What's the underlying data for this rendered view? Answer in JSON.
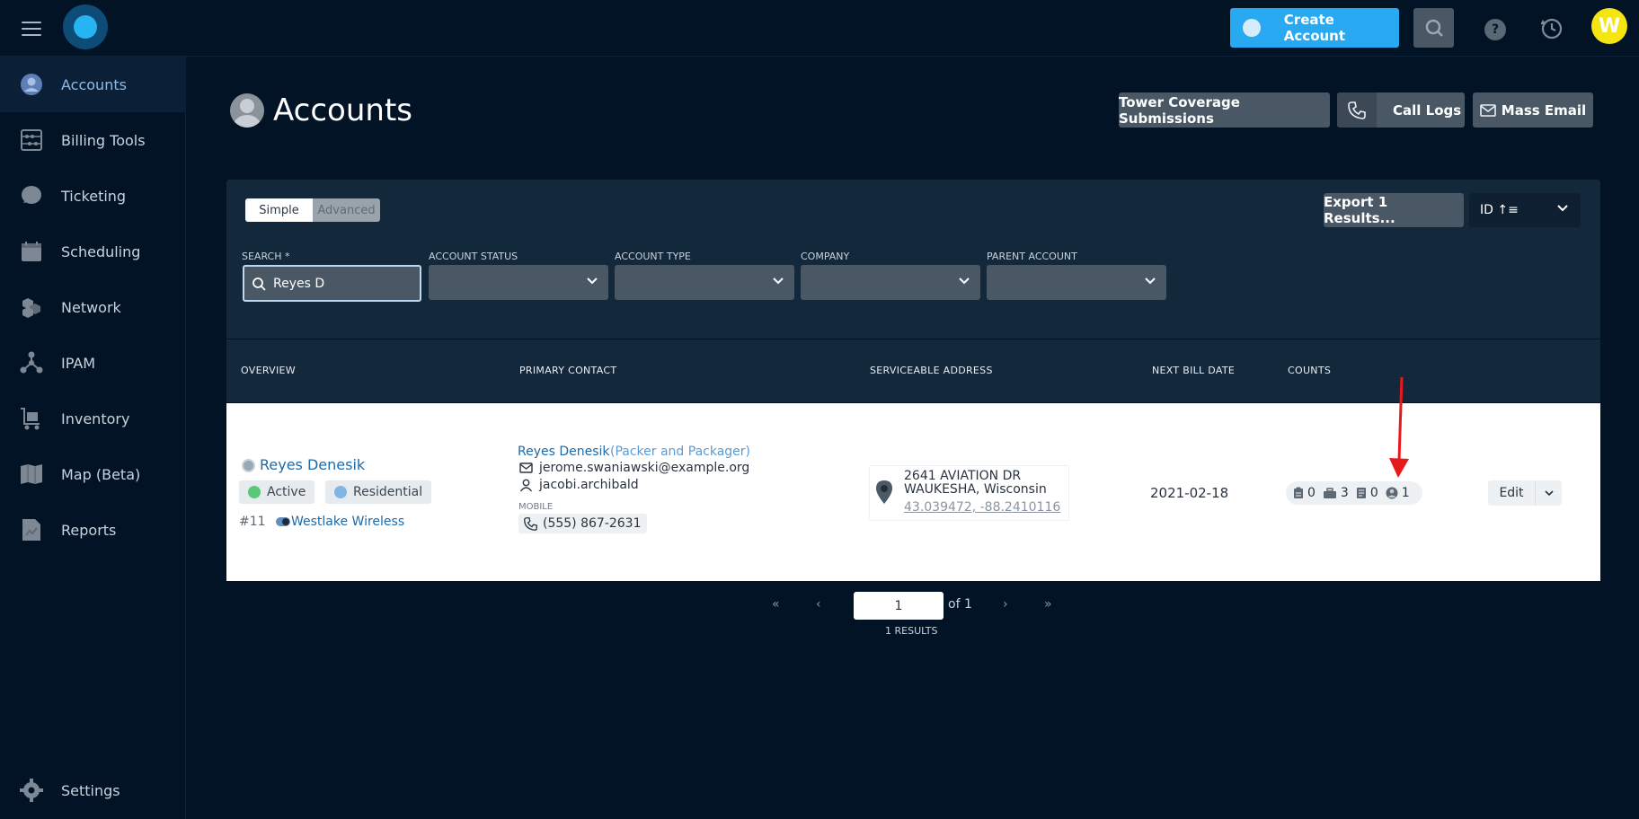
{
  "topbar": {
    "create_account_label": "Create Account",
    "help_label": "?",
    "user_initial": "W"
  },
  "sidebar": {
    "items": [
      {
        "label": "Accounts",
        "icon": "user-circle-icon",
        "active": true
      },
      {
        "label": "Billing Tools",
        "icon": "abacus-icon"
      },
      {
        "label": "Ticketing",
        "icon": "chat-bubble-icon"
      },
      {
        "label": "Scheduling",
        "icon": "calendar-icon"
      },
      {
        "label": "Network",
        "icon": "network-cubes-icon"
      },
      {
        "label": "IPAM",
        "icon": "ip-nodes-icon"
      },
      {
        "label": "Inventory",
        "icon": "cart-icon"
      },
      {
        "label": "Map (Beta)",
        "icon": "map-icon"
      },
      {
        "label": "Reports",
        "icon": "report-icon"
      }
    ],
    "settings_label": "Settings"
  },
  "header": {
    "title": "Accounts",
    "tower_btn": "Tower Coverage Submissions",
    "call_logs_btn": "Call Logs",
    "mass_email_btn": "Mass Email"
  },
  "filters": {
    "simple_label": "Simple",
    "advanced_label": "Advanced",
    "export_label": "Export 1 Results...",
    "sort_label": "ID ↑≡",
    "search_label": "SEARCH *",
    "search_value": "Reyes D",
    "account_status_label": "ACCOUNT STATUS",
    "account_type_label": "ACCOUNT TYPE",
    "company_label": "COMPANY",
    "parent_account_label": "PARENT ACCOUNT"
  },
  "table": {
    "headers": {
      "overview": "OVERVIEW",
      "primary_contact": "PRIMARY CONTACT",
      "serviceable_address": "SERVICEABLE ADDRESS",
      "next_bill_date": "NEXT BILL DATE",
      "counts": "COUNTS"
    },
    "row": {
      "name": "Reyes Denesik",
      "status": "Active",
      "type": "Residential",
      "id": "#11",
      "company": "Westlake Wireless",
      "contact_name": "Reyes Denesik",
      "contact_role": "(Packer and Packager)",
      "email": "jerome.swaniawski@example.org",
      "username": "jacobi.archibald",
      "mobile_label": "MOBILE",
      "phone": "(555) 867-2631",
      "address_line1": "2641 AVIATION DR",
      "address_line2": "WAUKESHA, Wisconsin",
      "coordinates": "43.039472, -88.2410116",
      "next_bill_date": "2021-02-18",
      "counts": {
        "tickets": "0",
        "jobs": "3",
        "invoices": "0",
        "contacts": "1"
      },
      "edit_label": "Edit"
    }
  },
  "pagination": {
    "first": "«",
    "prev": "‹",
    "page": "1",
    "of_label": "of 1",
    "next": "›",
    "last": "»",
    "results_label": "1 RESULTS"
  },
  "colors": {
    "background": "#021326",
    "accent": "#28a9f2",
    "button": "#4a5866",
    "active_status": "#5bc77a",
    "residential": "#7fb6e3",
    "arrow": "#e8191c"
  }
}
